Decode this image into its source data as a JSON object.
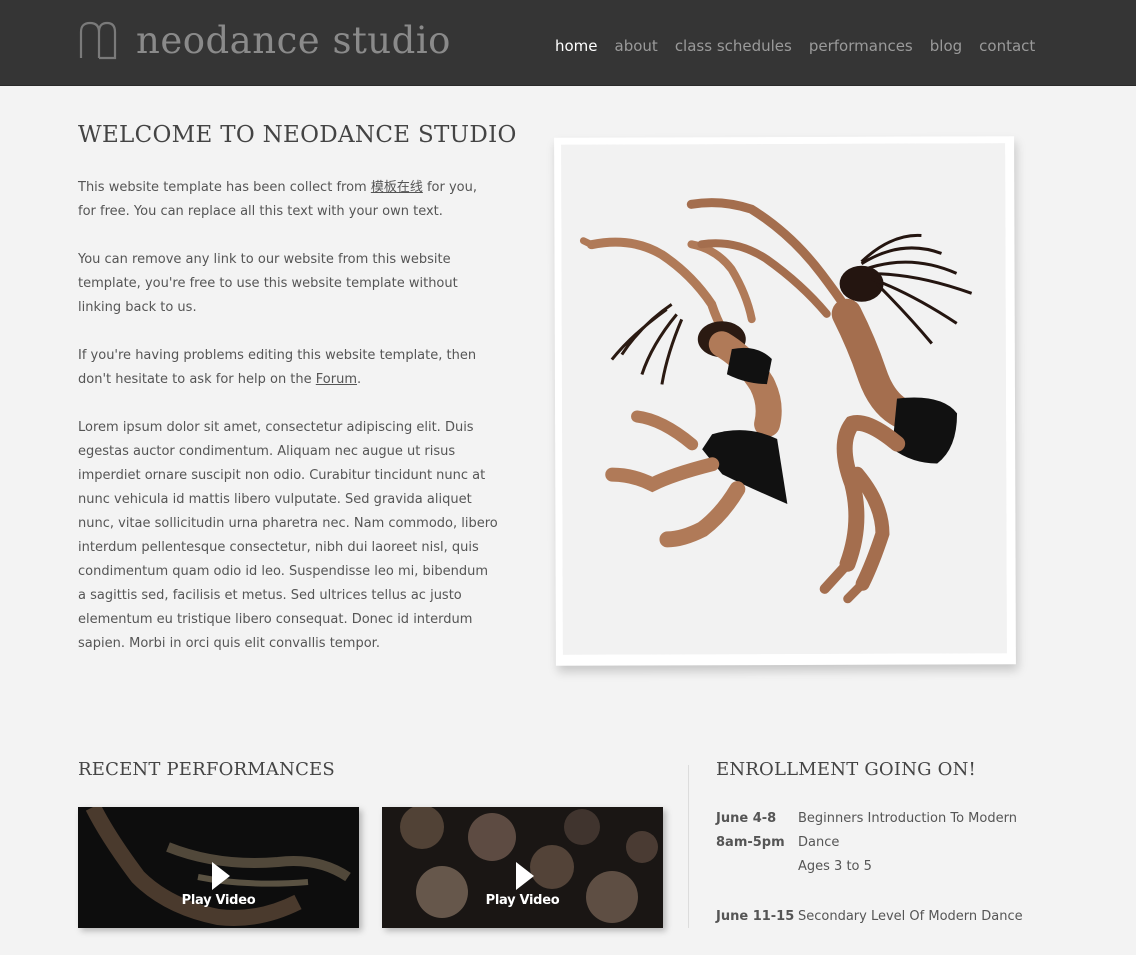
{
  "header": {
    "brand": "neodance studio",
    "nav": [
      {
        "label": "home",
        "active": true
      },
      {
        "label": "about",
        "active": false
      },
      {
        "label": "class schedules",
        "active": false
      },
      {
        "label": "performances",
        "active": false
      },
      {
        "label": "blog",
        "active": false
      },
      {
        "label": "contact",
        "active": false
      }
    ]
  },
  "welcome": {
    "title": "WELCOME TO NEODANCE STUDIO",
    "p1_before": "This website template has been collect from ",
    "p1_link": "模板在线",
    "p1_after": " for you, for free. You can replace all this text with your own text.",
    "p2": "You can remove any link to our website from this website template, you're free to use this website template without linking back to us.",
    "p3_before": "If you're having problems editing this website template, then don't hesitate to ask for help on the ",
    "p3_link": "Forum",
    "p3_after": ".",
    "p4": "Lorem ipsum dolor sit amet, consectetur adipiscing elit. Duis eges­tas auctor condimentum. Aliquam nec augue ut risus imperdiet ornare suscipit non odio. Curabitur tincidunt nunc at nunc vehicula id mattis libero vulputate. Sed gravida aliquet nunc, vitae sollicitudin urna pharetra nec. Nam commodo, libero interdum pellentesque consectetur, nibh dui laoreet nisl, quis condimentum quam odio id leo. Suspendisse leo mi, bibendum a sagittis sed, facilisis et metus. Sed ultrices tellus ac justo elementum eu tristique libero consequat. Donec id interdum sapien. Morbi in orci quis elit convallis tempor."
  },
  "recent": {
    "title": "RECENT PERFORMANCES",
    "videos": [
      {
        "label": "Play Video"
      },
      {
        "label": "Play Video"
      }
    ]
  },
  "enrollment": {
    "title": "ENROLLMENT GOING ON!",
    "items": [
      {
        "date_line1": "June 4-8",
        "date_line2": "8am-5pm",
        "desc_line1": "Beginners Introduction To Modern Dance",
        "desc_line2": "Ages 3 to 5"
      },
      {
        "date_line1": "June 11-15",
        "date_line2": "",
        "desc_line1": "Secondary Level Of Modern Dance",
        "desc_line2": ""
      }
    ]
  },
  "colors": {
    "header_bg": "#353535",
    "page_bg": "#f3f3f3",
    "nav_active": "#ffffff",
    "nav_inactive": "#9a9a9a"
  }
}
